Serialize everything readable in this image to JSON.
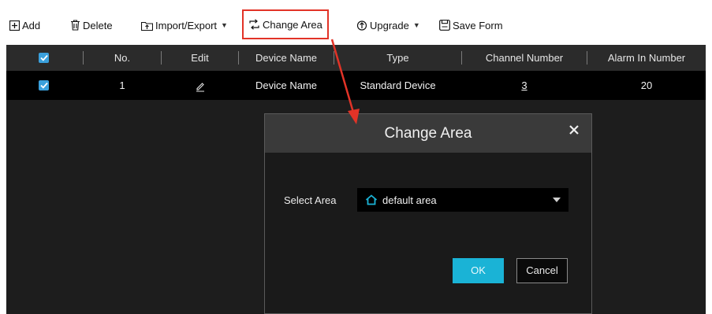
{
  "toolbar": {
    "add_label": "Add",
    "delete_label": "Delete",
    "import_export_label": "Import/Export",
    "change_area_label": "Change Area",
    "upgrade_label": "Upgrade",
    "save_form_label": "Save Form"
  },
  "table": {
    "columns": [
      "No.",
      "Edit",
      "Device Name",
      "Type",
      "Channel Number",
      "Alarm In Number"
    ],
    "rows": [
      {
        "no": "1",
        "device_name": "Device Name",
        "type": "Standard Device",
        "channel_number": "3",
        "alarm_in_number": "20"
      }
    ]
  },
  "dialog": {
    "title": "Change Area",
    "select_label": "Select Area",
    "selected_area": "default area",
    "ok_label": "OK",
    "cancel_label": "Cancel"
  },
  "colors": {
    "accent": "#1ab3d6",
    "checkbox": "#3aa0dc",
    "highlight": "#e23327"
  },
  "icons": [
    "add-icon",
    "delete-icon",
    "import-export-icon",
    "change-area-icon",
    "upgrade-icon",
    "save-form-icon",
    "edit-icon",
    "home-icon",
    "close-icon",
    "checkmark-icon"
  ]
}
